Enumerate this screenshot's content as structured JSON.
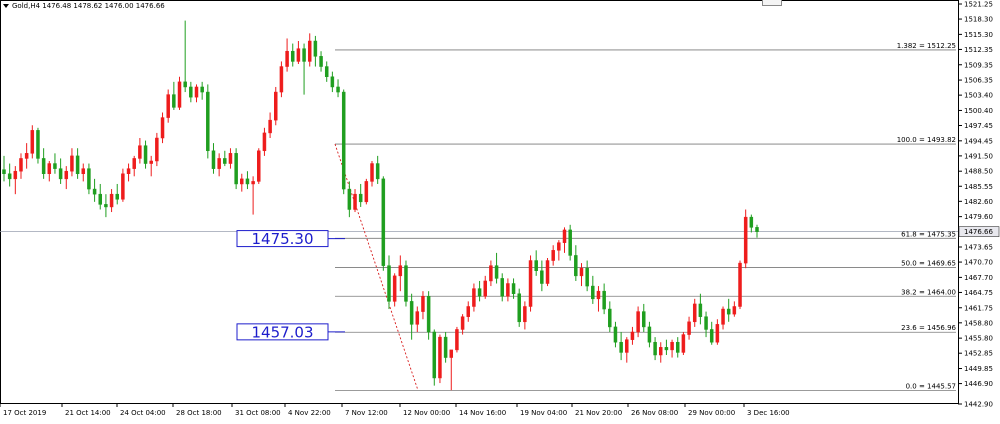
{
  "header": {
    "symbol_text": "Gold,H4  1476.48 1478.62 1476.00 1476.66"
  },
  "chart_data": {
    "type": "candlestick",
    "symbol": "Gold",
    "timeframe": "H4",
    "ohlc_current": {
      "open": 1476.48,
      "high": 1478.62,
      "low": 1476.0,
      "close": 1476.66
    },
    "ylim": [
      1442.9,
      1521.25
    ],
    "y_ticks": [
      "1521.25",
      "1518.30",
      "1515.30",
      "1512.35",
      "1509.35",
      "1506.35",
      "1503.40",
      "1500.40",
      "1497.45",
      "1494.45",
      "1491.50",
      "1488.50",
      "1485.55",
      "1482.60",
      "1479.60",
      "1476.66",
      "1473.65",
      "1470.70",
      "1467.70",
      "1464.75",
      "1461.75",
      "1458.80",
      "1455.80",
      "1452.85",
      "1449.85",
      "1446.90",
      "1442.90"
    ],
    "x_ticks": [
      "17 Oct 2019",
      "21 Oct 14:00",
      "24 Oct 04:00",
      "28 Oct 18:00",
      "31 Oct 08:00",
      "4 Nov 22:00",
      "7 Nov 12:00",
      "12 Nov 00:00",
      "14 Nov 16:00",
      "19 Nov 04:00",
      "21 Nov 20:00",
      "26 Nov 08:00",
      "29 Nov 00:00",
      "3 Dec 16:00"
    ],
    "current_price": "1476.66",
    "colors": {
      "bull": "#ee1c1c",
      "bear": "#1f9e1f",
      "level_box": "#1d1dcc",
      "fib_line": "#7a7a7a",
      "price_line": "#9aa0b0"
    },
    "fib_levels": [
      {
        "label": "1.382 = 1512.25",
        "value": 1512.25
      },
      {
        "label": "100.0 = 1493.82",
        "value": 1493.82
      },
      {
        "label": "61.8 = 1475.35",
        "value": 1475.35
      },
      {
        "label": "50.0 = 1469.65",
        "value": 1469.65
      },
      {
        "label": "38.2 = 1464.00",
        "value": 1464.0
      },
      {
        "label": "23.6 = 1456.96",
        "value": 1456.96
      },
      {
        "label": "0.0 = 1445.57",
        "value": 1445.57
      }
    ],
    "level_boxes": [
      {
        "label": "1475.30",
        "value": 1475.3
      },
      {
        "label": "1457.03",
        "value": 1457.03
      }
    ],
    "candles": [
      [
        1488.8,
        1491.5,
        1486.5,
        1488.0
      ],
      [
        1488.0,
        1490.0,
        1485.5,
        1487.0
      ],
      [
        1487.0,
        1489.5,
        1484.0,
        1488.5
      ],
      [
        1488.5,
        1492.0,
        1487.0,
        1491.0
      ],
      [
        1491.0,
        1494.0,
        1489.0,
        1492.0
      ],
      [
        1492.0,
        1497.5,
        1491.0,
        1496.5
      ],
      [
        1496.5,
        1497.0,
        1490.0,
        1491.0
      ],
      [
        1491.0,
        1493.0,
        1487.0,
        1488.0
      ],
      [
        1488.0,
        1490.5,
        1486.5,
        1490.0
      ],
      [
        1490.0,
        1492.0,
        1488.0,
        1489.0
      ],
      [
        1489.0,
        1491.0,
        1486.0,
        1487.0
      ],
      [
        1487.0,
        1489.5,
        1485.0,
        1488.5
      ],
      [
        1488.5,
        1493.0,
        1487.5,
        1491.5
      ],
      [
        1491.5,
        1493.0,
        1487.0,
        1488.0
      ],
      [
        1488.0,
        1490.0,
        1486.5,
        1489.0
      ],
      [
        1489.0,
        1490.0,
        1484.0,
        1485.0
      ],
      [
        1485.0,
        1487.0,
        1482.5,
        1484.0
      ],
      [
        1484.0,
        1486.0,
        1481.0,
        1482.0
      ],
      [
        1482.0,
        1484.0,
        1479.5,
        1481.5
      ],
      [
        1481.5,
        1485.0,
        1480.5,
        1484.0
      ],
      [
        1484.0,
        1486.0,
        1482.0,
        1483.0
      ],
      [
        1483.0,
        1489.0,
        1482.5,
        1488.0
      ],
      [
        1488.0,
        1490.0,
        1486.5,
        1489.0
      ],
      [
        1489.0,
        1491.5,
        1487.5,
        1491.0
      ],
      [
        1491.0,
        1495.0,
        1490.0,
        1493.5
      ],
      [
        1493.5,
        1494.5,
        1489.0,
        1490.0
      ],
      [
        1490.0,
        1491.5,
        1487.5,
        1490.5
      ],
      [
        1490.5,
        1496.0,
        1489.5,
        1495.0
      ],
      [
        1495.0,
        1500.0,
        1494.0,
        1499.0
      ],
      [
        1499.0,
        1504.5,
        1498.0,
        1503.5
      ],
      [
        1503.5,
        1506.0,
        1500.5,
        1501.0
      ],
      [
        1501.0,
        1507.0,
        1500.5,
        1506.0
      ],
      [
        1506.0,
        1518.0,
        1504.0,
        1505.0
      ],
      [
        1505.0,
        1506.0,
        1502.0,
        1503.0
      ],
      [
        1503.0,
        1505.5,
        1502.0,
        1505.0
      ],
      [
        1505.0,
        1506.0,
        1502.5,
        1504.0
      ],
      [
        1504.0,
        1505.5,
        1491.0,
        1492.5
      ],
      [
        1492.5,
        1494.0,
        1488.0,
        1489.0
      ],
      [
        1489.0,
        1492.0,
        1487.5,
        1491.0
      ],
      [
        1491.0,
        1492.5,
        1489.5,
        1490.0
      ],
      [
        1490.0,
        1493.0,
        1489.0,
        1492.0
      ],
      [
        1492.0,
        1493.0,
        1485.0,
        1486.0
      ],
      [
        1486.0,
        1488.0,
        1484.5,
        1487.0
      ],
      [
        1487.0,
        1488.5,
        1485.0,
        1486.0
      ],
      [
        1486.0,
        1487.5,
        1480.0,
        1486.5
      ],
      [
        1486.5,
        1493.0,
        1486.0,
        1492.5
      ],
      [
        1492.5,
        1497.0,
        1491.5,
        1496.0
      ],
      [
        1496.0,
        1500.0,
        1495.0,
        1498.5
      ],
      [
        1498.5,
        1505.0,
        1497.5,
        1504.0
      ],
      [
        1504.0,
        1510.0,
        1503.0,
        1509.0
      ],
      [
        1509.0,
        1514.5,
        1508.0,
        1512.0
      ],
      [
        1512.0,
        1513.5,
        1509.0,
        1510.0
      ],
      [
        1510.0,
        1514.0,
        1509.5,
        1512.5
      ],
      [
        1512.5,
        1513.5,
        1503.5,
        1510.0
      ],
      [
        1510.0,
        1515.5,
        1509.0,
        1514.0
      ],
      [
        1514.0,
        1515.0,
        1509.0,
        1511.0
      ],
      [
        1511.0,
        1512.0,
        1508.0,
        1509.0
      ],
      [
        1509.0,
        1510.0,
        1506.0,
        1507.0
      ],
      [
        1507.0,
        1508.0,
        1504.0,
        1505.0
      ],
      [
        1505.0,
        1506.5,
        1503.0,
        1504.0
      ],
      [
        1504.0,
        1504.5,
        1484.0,
        1485.0
      ],
      [
        1485.0,
        1486.5,
        1479.5,
        1481.0
      ],
      [
        1481.0,
        1485.0,
        1480.5,
        1484.0
      ],
      [
        1484.0,
        1486.0,
        1481.5,
        1482.5
      ],
      [
        1482.5,
        1487.0,
        1482.0,
        1486.5
      ],
      [
        1486.5,
        1490.5,
        1485.5,
        1490.0
      ],
      [
        1490.0,
        1491.5,
        1486.0,
        1487.0
      ],
      [
        1487.0,
        1487.5,
        1469.0,
        1470.0
      ],
      [
        1470.0,
        1472.0,
        1461.5,
        1463.0
      ],
      [
        1463.0,
        1468.5,
        1462.0,
        1468.0
      ],
      [
        1468.0,
        1472.0,
        1465.0,
        1470.0
      ],
      [
        1470.0,
        1471.0,
        1462.0,
        1463.0
      ],
      [
        1463.0,
        1464.5,
        1455.5,
        1458.5
      ],
      [
        1458.5,
        1462.0,
        1457.0,
        1461.0
      ],
      [
        1461.0,
        1465.0,
        1459.5,
        1464.0
      ],
      [
        1464.0,
        1465.0,
        1455.5,
        1457.0
      ],
      [
        1457.0,
        1457.5,
        1446.5,
        1448.0
      ],
      [
        1448.0,
        1456.5,
        1447.0,
        1456.0
      ],
      [
        1456.0,
        1457.0,
        1451.0,
        1452.0
      ],
      [
        1452.0,
        1453.0,
        1445.6,
        1453.5
      ],
      [
        1453.5,
        1458.0,
        1453.0,
        1457.5
      ],
      [
        1457.5,
        1460.5,
        1456.5,
        1460.0
      ],
      [
        1460.0,
        1463.0,
        1459.0,
        1462.0
      ],
      [
        1462.0,
        1466.5,
        1461.0,
        1465.5
      ],
      [
        1465.5,
        1467.0,
        1463.0,
        1464.0
      ],
      [
        1464.0,
        1468.0,
        1463.5,
        1467.0
      ],
      [
        1467.0,
        1471.0,
        1466.0,
        1470.0
      ],
      [
        1470.0,
        1472.5,
        1466.5,
        1467.5
      ],
      [
        1467.5,
        1468.5,
        1463.0,
        1464.0
      ],
      [
        1464.0,
        1467.5,
        1463.0,
        1466.5
      ],
      [
        1466.5,
        1467.5,
        1463.5,
        1464.5
      ],
      [
        1464.5,
        1465.5,
        1458.0,
        1459.0
      ],
      [
        1459.0,
        1463.0,
        1457.5,
        1462.0
      ],
      [
        1462.0,
        1472.0,
        1461.0,
        1471.0
      ],
      [
        1471.0,
        1473.0,
        1468.0,
        1469.0
      ],
      [
        1469.0,
        1471.0,
        1465.0,
        1466.5
      ],
      [
        1466.5,
        1471.5,
        1466.0,
        1471.0
      ],
      [
        1471.0,
        1474.0,
        1470.0,
        1473.0
      ],
      [
        1473.0,
        1475.0,
        1471.0,
        1474.5
      ],
      [
        1474.5,
        1477.5,
        1472.5,
        1477.0
      ],
      [
        1477.0,
        1478.0,
        1471.0,
        1472.0
      ],
      [
        1472.0,
        1474.0,
        1467.0,
        1468.0
      ],
      [
        1468.0,
        1470.5,
        1466.0,
        1469.5
      ],
      [
        1469.5,
        1471.0,
        1465.0,
        1466.0
      ],
      [
        1466.0,
        1468.0,
        1462.5,
        1463.5
      ],
      [
        1463.5,
        1466.0,
        1461.0,
        1465.0
      ],
      [
        1465.0,
        1466.5,
        1460.5,
        1461.5
      ],
      [
        1461.5,
        1463.0,
        1457.0,
        1458.0
      ],
      [
        1458.0,
        1459.0,
        1454.0,
        1455.0
      ],
      [
        1455.0,
        1457.0,
        1451.5,
        1453.0
      ],
      [
        1453.0,
        1456.0,
        1451.0,
        1455.5
      ],
      [
        1455.5,
        1458.0,
        1454.5,
        1457.0
      ],
      [
        1457.0,
        1462.0,
        1456.0,
        1461.0
      ],
      [
        1461.0,
        1462.5,
        1457.0,
        1458.0
      ],
      [
        1458.0,
        1459.0,
        1454.0,
        1455.0
      ],
      [
        1455.0,
        1456.0,
        1451.5,
        1452.5
      ],
      [
        1452.5,
        1455.0,
        1451.0,
        1454.0
      ],
      [
        1454.0,
        1455.5,
        1452.5,
        1453.5
      ],
      [
        1453.5,
        1455.5,
        1452.0,
        1455.0
      ],
      [
        1455.0,
        1456.0,
        1452.0,
        1453.0
      ],
      [
        1453.0,
        1457.0,
        1452.5,
        1456.5
      ],
      [
        1456.5,
        1460.0,
        1455.5,
        1459.0
      ],
      [
        1459.0,
        1463.5,
        1458.0,
        1462.5
      ],
      [
        1462.5,
        1464.5,
        1458.5,
        1460.0
      ],
      [
        1460.0,
        1461.0,
        1456.0,
        1457.5
      ],
      [
        1457.5,
        1459.0,
        1454.5,
        1455.0
      ],
      [
        1455.0,
        1459.5,
        1454.5,
        1458.5
      ],
      [
        1458.5,
        1462.0,
        1457.5,
        1461.5
      ],
      [
        1461.5,
        1463.5,
        1459.0,
        1460.5
      ],
      [
        1460.5,
        1463.0,
        1460.0,
        1462.0
      ],
      [
        1462.0,
        1471.0,
        1461.5,
        1470.5
      ],
      [
        1470.5,
        1481.0,
        1469.5,
        1479.5
      ],
      [
        1479.5,
        1480.0,
        1476.5,
        1477.5
      ],
      [
        1477.5,
        1478.0,
        1475.5,
        1476.66
      ]
    ]
  }
}
